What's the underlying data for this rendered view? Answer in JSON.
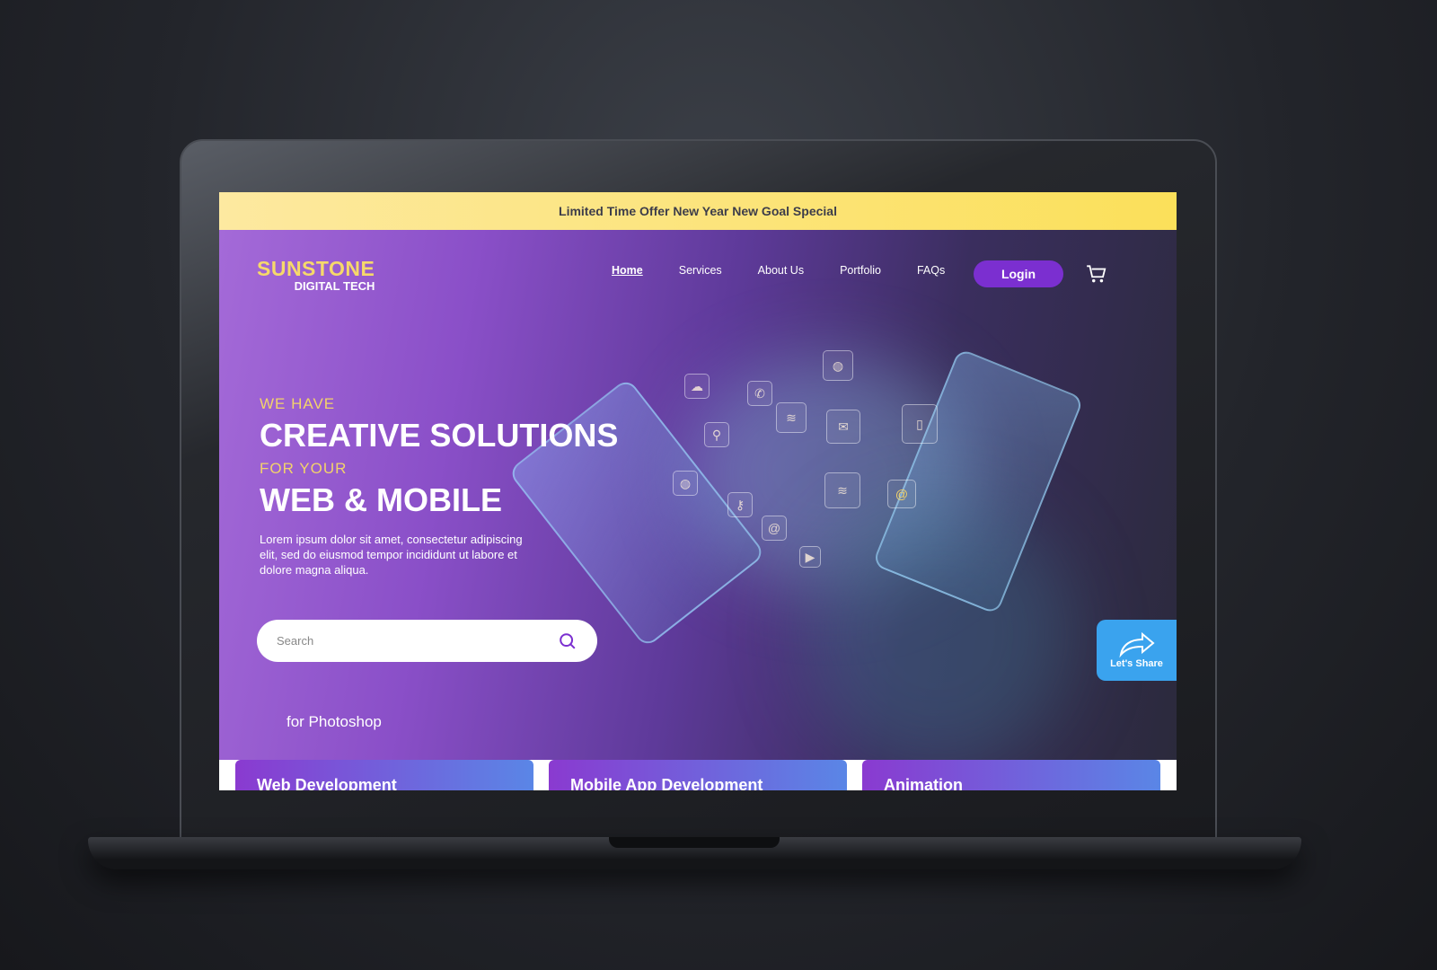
{
  "banner": {
    "text": "Limited Time Offer New Year New Goal Special"
  },
  "logo": {
    "name": "SUNSTONE",
    "tagline": "DIGITAL TECH"
  },
  "nav": {
    "items": [
      {
        "label": "Home",
        "active": true
      },
      {
        "label": "Services"
      },
      {
        "label": "About Us"
      },
      {
        "label": "Portfolio"
      },
      {
        "label": "FAQs"
      }
    ],
    "login": "Login",
    "cart_icon": "cart-icon"
  },
  "hero": {
    "line1": "WE HAVE",
    "line2": "CREATIVE SOLUTIONS",
    "line3": "FOR YOUR",
    "line4": "WEB & MOBILE",
    "body": "Lorem ipsum dolor sit amet, consectetur adipiscing elit, sed do eiusmod tempor incididunt ut labore et dolore magna aliqua.",
    "search_placeholder": "Search",
    "footnote": "for Photoshop"
  },
  "share": {
    "label": "Let's Share",
    "icon": "share-arrow-icon"
  },
  "cards": [
    {
      "title": "Web Development"
    },
    {
      "title": "Mobile App Development"
    },
    {
      "title": "Animation"
    }
  ],
  "colors": {
    "accent": "#7b2fd0",
    "banner": "#fbe05a",
    "logo": "#f6d96a",
    "share": "#3aa3ee"
  }
}
